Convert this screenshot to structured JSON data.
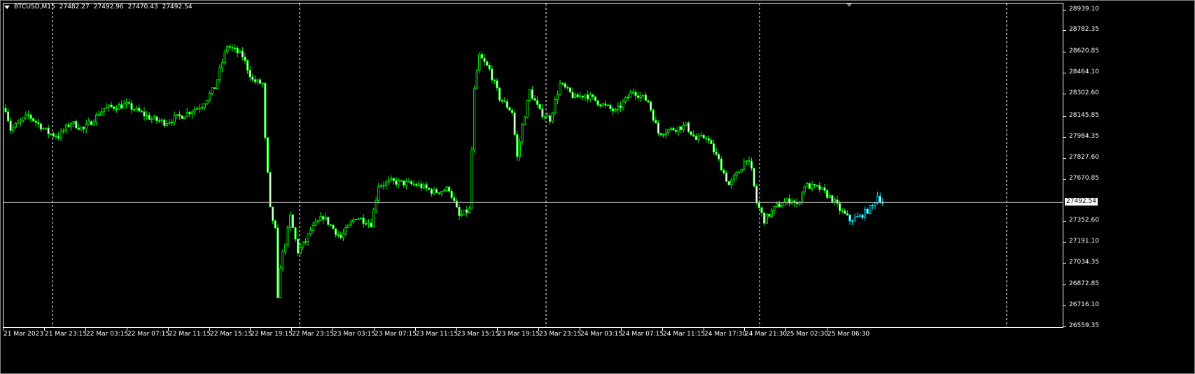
{
  "header": {
    "symbol": "BTCUSD,M15",
    "open": "27482.27",
    "high": "27492.96",
    "low": "27470.43",
    "close": "27492.54"
  },
  "colors": {
    "background": "#000000",
    "bull": "#00ff00",
    "bear_body": "#ffffff",
    "recent": "#00e5ff",
    "grid": "#ffffff",
    "bid_line": "#c0c0c0"
  },
  "chart_data": {
    "type": "candlestick",
    "symbol": "BTCUSD",
    "timeframe": "M15",
    "ylim": [
      26559.35,
      28939.1
    ],
    "bid": 27492.54,
    "y_ticks": [
      "28939.10",
      "28782.35",
      "28620.85",
      "28464.10",
      "28302.60",
      "28145.85",
      "27984.35",
      "27827.60",
      "27670.85",
      "27352.60",
      "27191.10",
      "27034.35",
      "26872.85",
      "26716.10",
      "26559.35"
    ],
    "x_ticks": [
      "21 Mar 2023",
      "21 Mar 23:15",
      "22 Mar 03:15",
      "22 Mar 07:15",
      "22 Mar 11:15",
      "22 Mar 15:15",
      "22 Mar 19:15",
      "22 Mar 23:15",
      "23 Mar 03:15",
      "23 Mar 07:15",
      "23 Mar 11:15",
      "23 Mar 15:15",
      "23 Mar 19:15",
      "23 Mar 23:15",
      "24 Mar 03:15",
      "24 Mar 07:15",
      "24 Mar 11:15",
      "24 Mar 17:30",
      "24 Mar 21:30",
      "25 Mar 02:30",
      "25 Mar 06:30"
    ],
    "close_path": [
      [
        0,
        28198
      ],
      [
        2,
        28040
      ],
      [
        9,
        28145
      ],
      [
        17,
        28014
      ],
      [
        21,
        27988
      ],
      [
        26,
        28093
      ],
      [
        31,
        28040
      ],
      [
        39,
        28198
      ],
      [
        48,
        28224
      ],
      [
        58,
        28119
      ],
      [
        63,
        28093
      ],
      [
        70,
        28145
      ],
      [
        78,
        28224
      ],
      [
        83,
        28356
      ],
      [
        88,
        28670
      ],
      [
        94,
        28592
      ],
      [
        98,
        28408
      ],
      [
        102,
        28382
      ],
      [
        103,
        27962
      ],
      [
        105,
        27437
      ],
      [
        107,
        27280
      ],
      [
        108,
        26754
      ],
      [
        109,
        27017
      ],
      [
        112,
        27280
      ],
      [
        113,
        27385
      ],
      [
        116,
        27122
      ],
      [
        119,
        27201
      ],
      [
        121,
        27280
      ],
      [
        126,
        27385
      ],
      [
        133,
        27227
      ],
      [
        139,
        27385
      ],
      [
        145,
        27332
      ],
      [
        148,
        27621
      ],
      [
        153,
        27647
      ],
      [
        164,
        27621
      ],
      [
        170,
        27568
      ],
      [
        176,
        27595
      ],
      [
        180,
        27385
      ],
      [
        184,
        27437
      ],
      [
        186,
        28330
      ],
      [
        188,
        28592
      ],
      [
        192,
        28487
      ],
      [
        196,
        28277
      ],
      [
        201,
        28172
      ],
      [
        203,
        27830
      ],
      [
        205,
        28067
      ],
      [
        208,
        28330
      ],
      [
        212,
        28172
      ],
      [
        216,
        28119
      ],
      [
        220,
        28382
      ],
      [
        226,
        28277
      ],
      [
        230,
        28303
      ],
      [
        237,
        28224
      ],
      [
        242,
        28172
      ],
      [
        249,
        28330
      ],
      [
        255,
        28251
      ],
      [
        259,
        28014
      ],
      [
        264,
        28040
      ],
      [
        270,
        28067
      ],
      [
        274,
        27962
      ],
      [
        278,
        27988
      ],
      [
        283,
        27804
      ],
      [
        287,
        27621
      ],
      [
        291,
        27726
      ],
      [
        294,
        27830
      ],
      [
        296,
        27726
      ],
      [
        298,
        27490
      ],
      [
        301,
        27359
      ],
      [
        306,
        27464
      ],
      [
        312,
        27516
      ],
      [
        314,
        27464
      ],
      [
        317,
        27621
      ],
      [
        323,
        27595
      ],
      [
        328,
        27516
      ],
      [
        331,
        27437
      ],
      [
        335,
        27359
      ],
      [
        339,
        27385
      ],
      [
        344,
        27464
      ],
      [
        346,
        27542
      ],
      [
        348,
        27492
      ]
    ]
  }
}
